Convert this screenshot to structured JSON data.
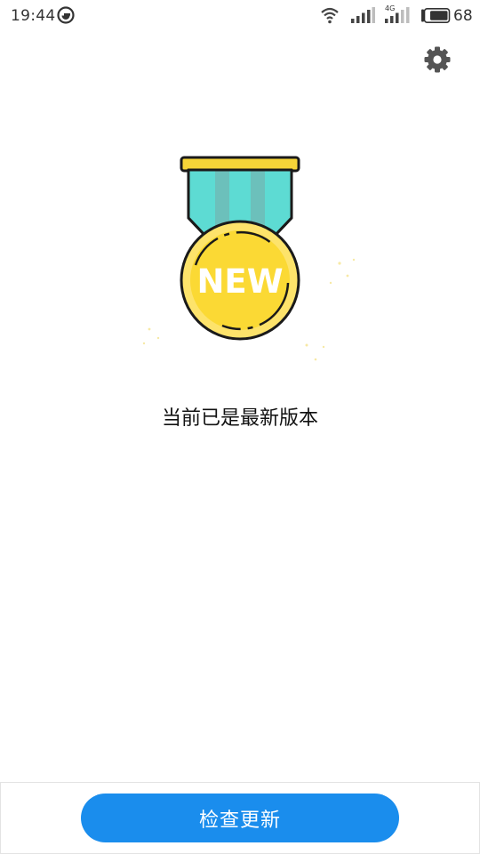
{
  "status_bar": {
    "time": "19:44",
    "network_type": "4G",
    "battery_level": "68"
  },
  "medal": {
    "label": "NEW",
    "ribbon_color": "#5ddbd3",
    "ribbon_stripe_color": "#6cc0bb",
    "gold_color": "#fbd934",
    "gold_rim_color": "#fde36b",
    "bar_color": "#f6d538",
    "outline_color": "#1a1a1a"
  },
  "message": "当前已是最新版本",
  "actions": {
    "check_update_label": "检查更新"
  },
  "colors": {
    "primary": "#1a8ded",
    "settings_icon": "#555555"
  }
}
